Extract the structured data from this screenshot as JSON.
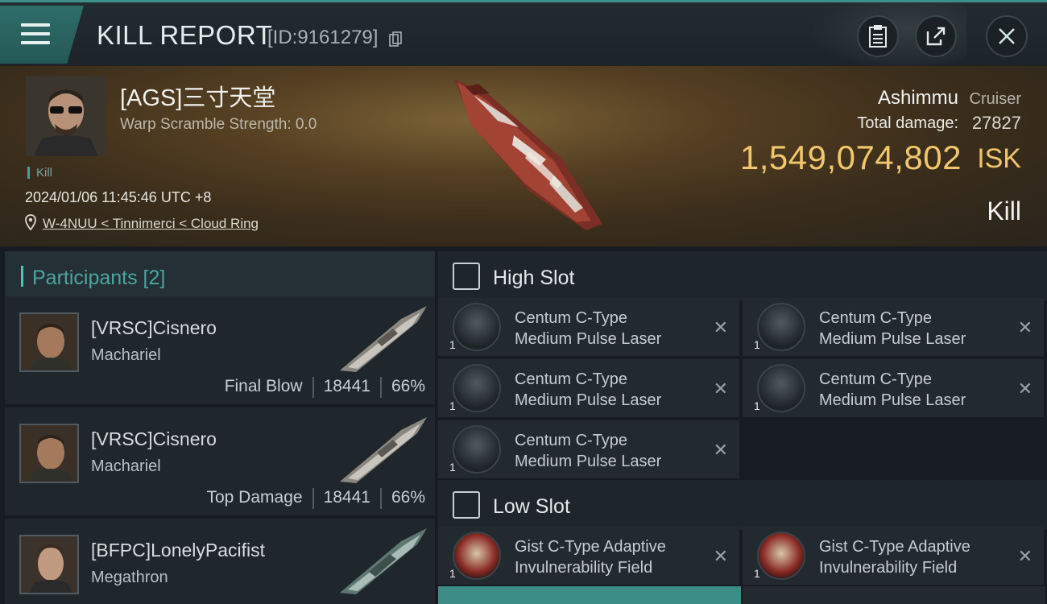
{
  "header": {
    "title": "KILL REPORT",
    "kill_id": "[ID:9161279]",
    "icons": [
      "menu-icon",
      "copy-icon",
      "clipboard-icon",
      "share-icon",
      "close-icon"
    ]
  },
  "victim": {
    "name": "[AGS]三寸天堂",
    "warp_scramble": "Warp Scramble Strength: 0.0",
    "kill_tag": "Kill",
    "datetime": "2024/01/06 11:45:46 UTC +8",
    "location": "W-4NUU < Tinnimerci < Cloud Ring",
    "ship_name": "Ashimmu",
    "ship_class": "Cruiser",
    "damage_label": "Total damage:",
    "damage_value": "27827",
    "isk_value": "1,549,074,802",
    "isk_unit": "ISK",
    "result": "Kill"
  },
  "participants": {
    "title": "Participants [2]",
    "rows": [
      {
        "name": "[VRSC]Cisnero",
        "ship": "Machariel",
        "role": "Final Blow",
        "damage": "18441",
        "percent": "66%"
      },
      {
        "name": "[VRSC]Cisnero",
        "ship": "Machariel",
        "role": "Top Damage",
        "damage": "18441",
        "percent": "66%"
      },
      {
        "name": "[BFPC]LonelyPacifist",
        "ship": "Megathron",
        "badge": "i"
      }
    ]
  },
  "slots": {
    "high": {
      "title": "High Slot",
      "modules": [
        {
          "line1": "Centum C-Type",
          "line2": "Medium Pulse Laser",
          "qty": "1"
        },
        {
          "line1": "Centum C-Type",
          "line2": "Medium Pulse Laser",
          "qty": "1"
        },
        {
          "line1": "Centum C-Type",
          "line2": "Medium Pulse Laser",
          "qty": "1"
        },
        {
          "line1": "Centum C-Type",
          "line2": "Medium Pulse Laser",
          "qty": "1"
        },
        {
          "line1": "Centum C-Type",
          "line2": "Medium Pulse Laser",
          "qty": "1"
        }
      ]
    },
    "low": {
      "title": "Low Slot",
      "modules": [
        {
          "line1": "Gist C-Type Adaptive",
          "line2": "Invulnerability Field",
          "qty": "1"
        },
        {
          "line1": "Gist C-Type Adaptive",
          "line2": "Invulnerability Field",
          "qty": "1"
        }
      ]
    },
    "remove_glyph": "✕"
  },
  "colors": {
    "accent": "#3d8f8b",
    "isk": "#f2c66b",
    "participants_title": "#4aa59f"
  }
}
